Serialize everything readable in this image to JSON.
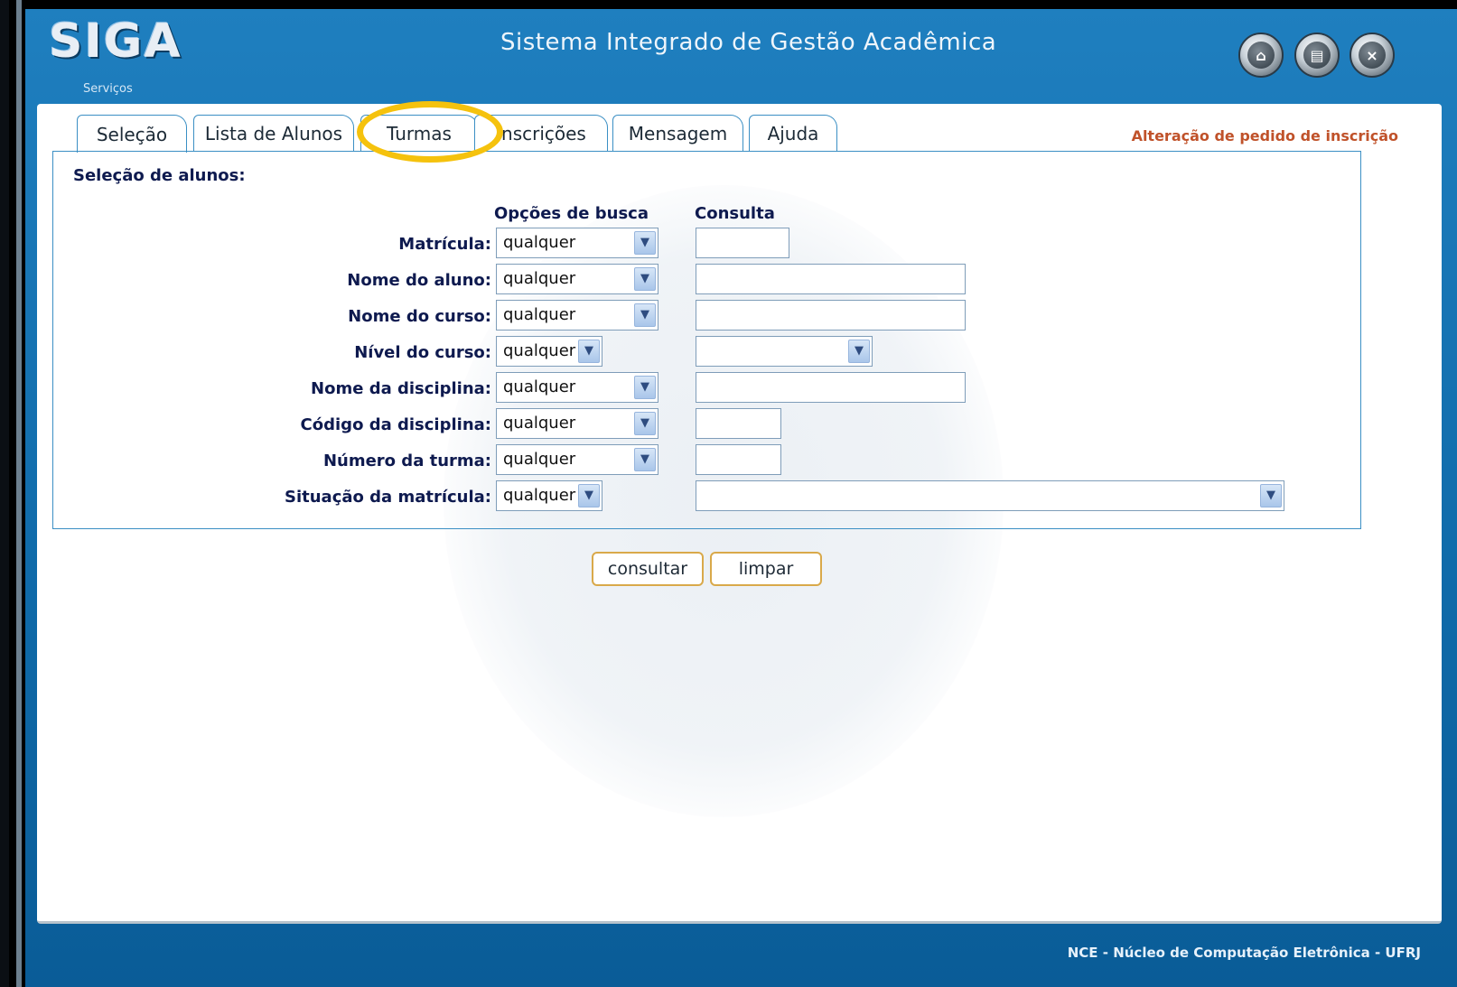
{
  "app": {
    "logo": "SIGA",
    "subtitle": "Serviços",
    "title": "Sistema Integrado de Gestão Acadêmica",
    "header_buttons": [
      {
        "name": "home",
        "icon": "home-icon"
      },
      {
        "name": "print",
        "icon": "print-icon"
      },
      {
        "name": "close",
        "icon": "close-icon"
      }
    ]
  },
  "tabs": [
    {
      "label": "Seleção",
      "active": true
    },
    {
      "label": "Lista de Alunos"
    },
    {
      "label": "Turmas",
      "highlighted": true
    },
    {
      "label": "Inscrições"
    },
    {
      "label": "Mensagem"
    },
    {
      "label": "Ajuda"
    }
  ],
  "page_subtitle": "Alteração de pedido de inscrição",
  "form": {
    "section_title": "Seleção de alunos:",
    "col_options": "Opções de busca",
    "col_query": "Consulta",
    "rows": [
      {
        "label": "Matrícula:",
        "option": "qualquer"
      },
      {
        "label": "Nome do aluno:",
        "option": "qualquer"
      },
      {
        "label": "Nome do curso:",
        "option": "qualquer"
      },
      {
        "label": "Nível do curso:",
        "option": "qualquer"
      },
      {
        "label": "Nome da disciplina:",
        "option": "qualquer"
      },
      {
        "label": "Código da disciplina:",
        "option": "qualquer"
      },
      {
        "label": "Número da turma:",
        "option": "qualquer"
      },
      {
        "label": "Situação da matrícula:",
        "option": "qualquer"
      }
    ]
  },
  "buttons": {
    "consultar": "consultar",
    "limpar": "limpar"
  },
  "footer": "NCE - Núcleo de Computação Eletrônica - UFRJ",
  "colors": {
    "highlight": "#f5c20d",
    "accent": "#1f7fbf",
    "subtitle": "#c0522a"
  }
}
